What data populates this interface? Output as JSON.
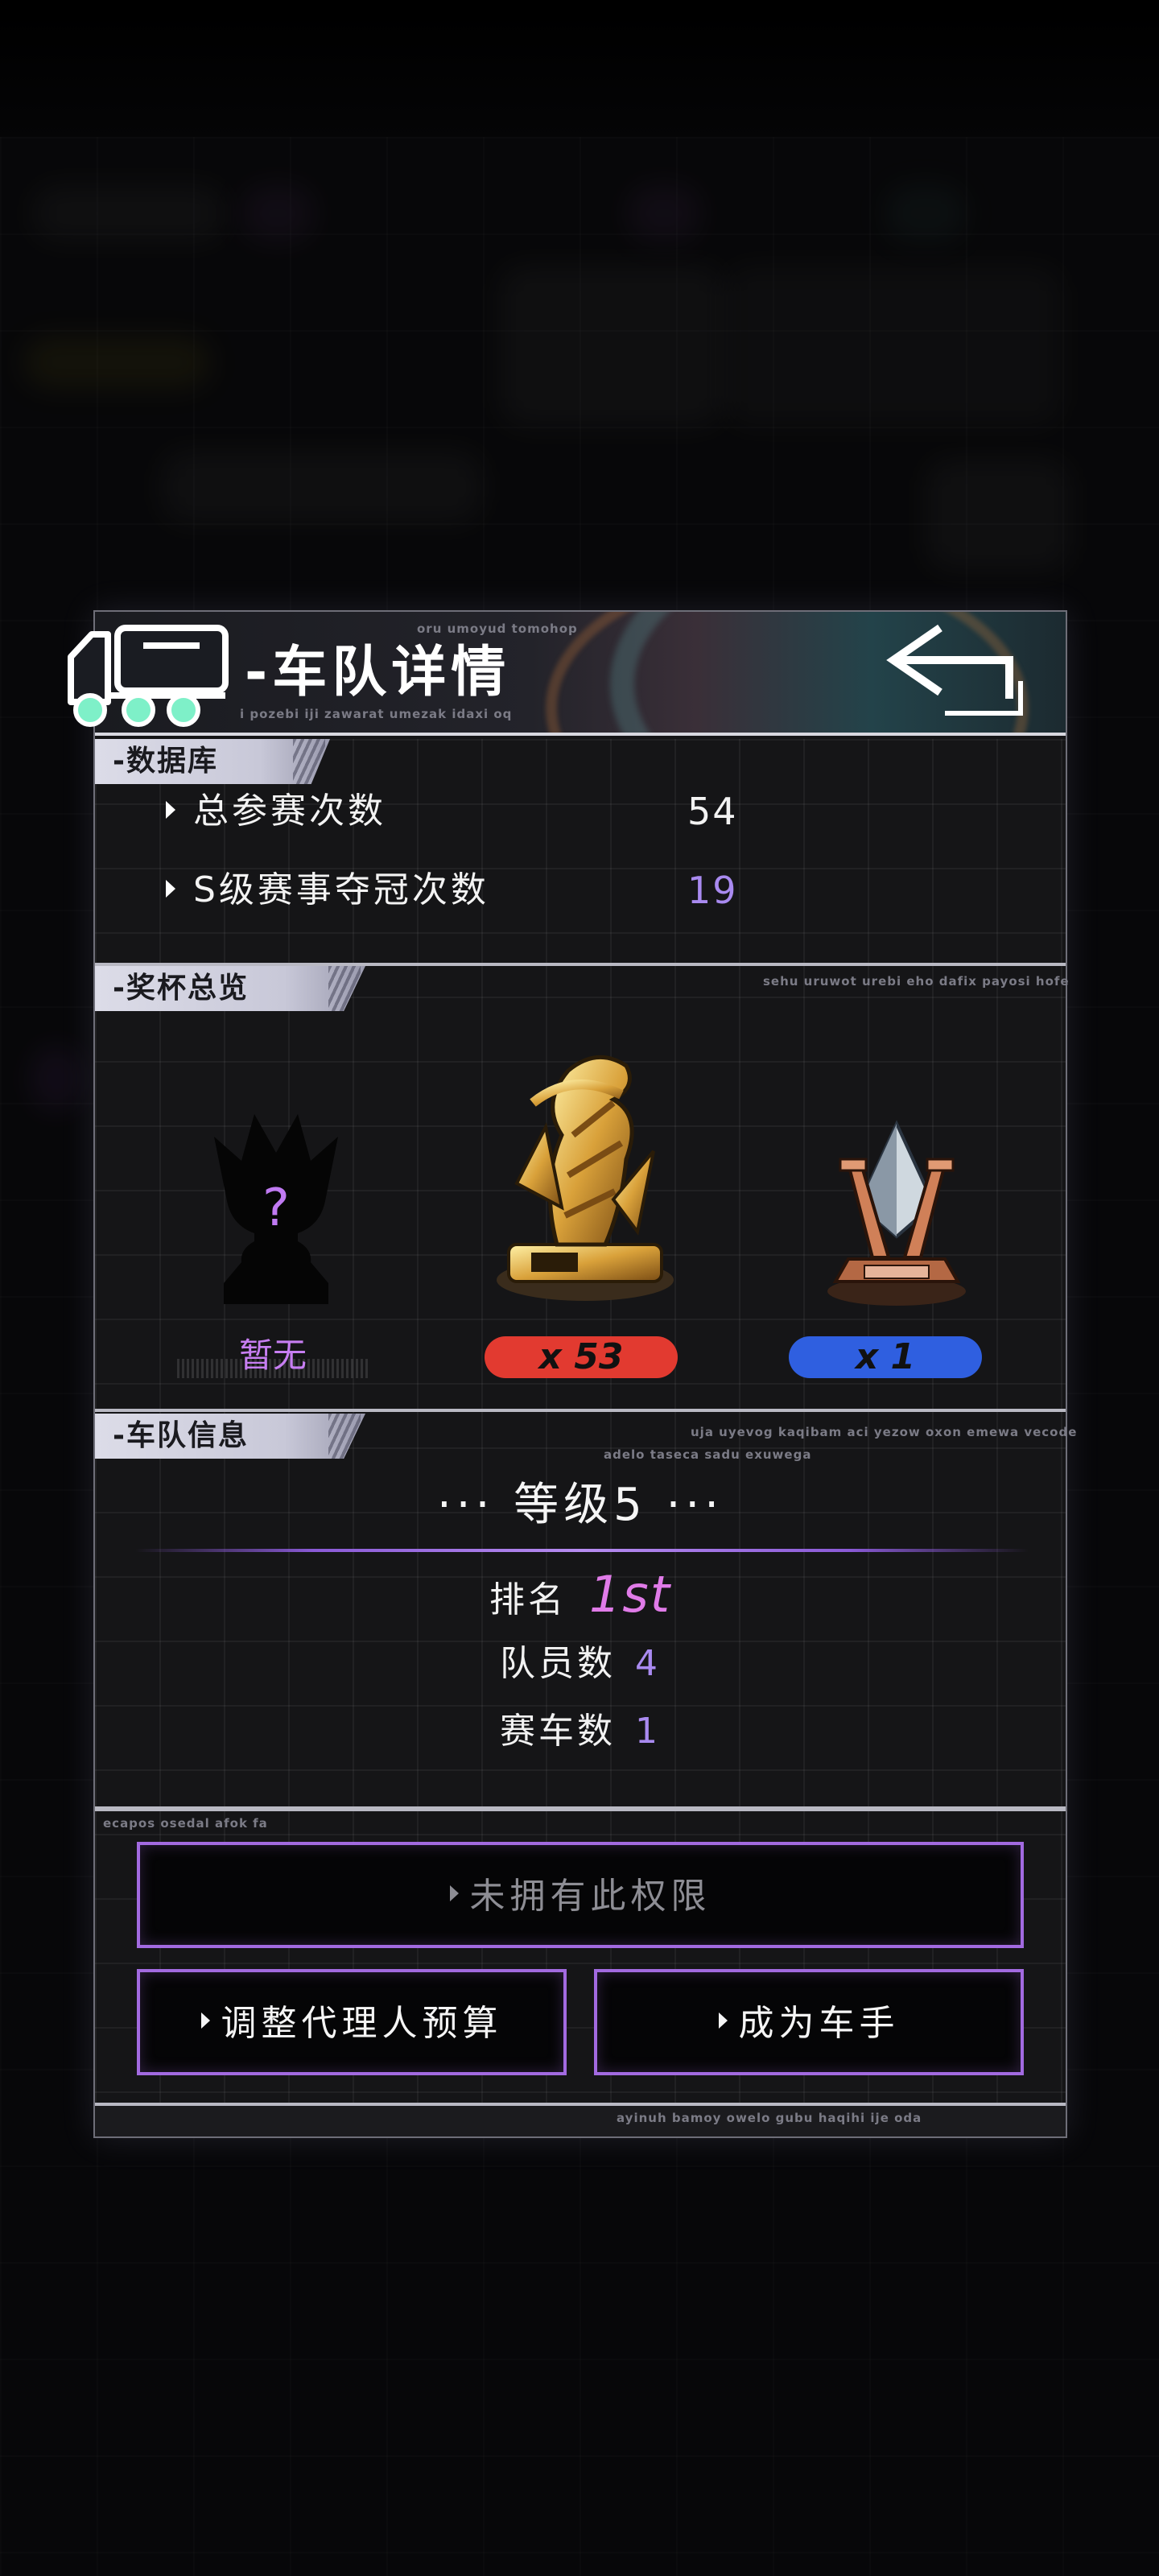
{
  "header": {
    "title": "-车队详情",
    "tiny_top": "oru umoyud tomohop",
    "tiny_bottom": "i pozebi iji zawarat umezak idaxi oq"
  },
  "database": {
    "tab": "-数据库",
    "rows": [
      {
        "label": "总参赛次数",
        "value": "54"
      },
      {
        "label": "S级赛事夺冠次数",
        "value": "19"
      }
    ]
  },
  "trophies": {
    "tab": "-奖杯总览",
    "tiny": "sehu uruwot urebi eho dafix payosi hofe",
    "items": [
      {
        "label": "暂无",
        "question_mark": "?"
      },
      {
        "label": "x 53"
      },
      {
        "label": "x 1"
      }
    ]
  },
  "team_info": {
    "tab": "-车队信息",
    "tiny_1": "uja uyevog kaqibam aci yezow oxon emewa vecode",
    "tiny_2": "adelo taseca sadu exuwega",
    "level": "···   等级5   ···",
    "rank_label": "排名",
    "rank_value": "1st",
    "members_label": "队员数",
    "members_value": "4",
    "cars_label": "赛车数",
    "cars_value": "1"
  },
  "actions": {
    "tiny": "ecapos osedal afok fa",
    "no_permission": "未拥有此权限",
    "adjust_budget": "调整代理人预算",
    "become_driver": "成为车手"
  },
  "footer": {
    "tiny": "ayinuh bamoy owelo gubu haqihi ije oda"
  },
  "colors": {
    "accent_purple": "#a26ae0",
    "value_purple": "#a98af0",
    "rank_pink": "#e07be8",
    "gold_badge": "#e23a30",
    "blue_badge": "#2f5fe0"
  }
}
